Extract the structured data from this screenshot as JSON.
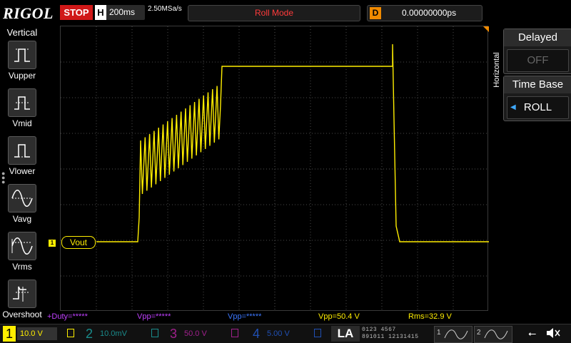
{
  "topbar": {
    "logo": "RIGOL",
    "run_state": "STOP",
    "timebase_tag": "H",
    "timebase": "200ms",
    "sample_rate": "2.50MSa/s",
    "mode": "Roll Mode",
    "delay_tag": "D",
    "delay": "0.00000000ps"
  },
  "left_menu": {
    "title": "Vertical",
    "items": [
      {
        "label": "Vupper",
        "icon": "vupper-icon"
      },
      {
        "label": "Vmid",
        "icon": "vmid-icon"
      },
      {
        "label": "Vlower",
        "icon": "vlower-icon"
      },
      {
        "label": "Vavg",
        "icon": "vavg-icon"
      },
      {
        "label": "Vrms",
        "icon": "vrms-icon"
      },
      {
        "label": "Overshoot",
        "icon": "overshoot-icon"
      }
    ]
  },
  "right_panel": {
    "section": "Horizontal",
    "delayed_title": "Delayed",
    "delayed_value": "OFF",
    "timebase_title": "Time Base",
    "timebase_value": "ROLL"
  },
  "trace": {
    "label_num": "1",
    "label": "Vout",
    "color": "#ffee00"
  },
  "measurements": [
    {
      "text": "+Duty=*****",
      "color": "#c040ff"
    },
    {
      "text": "Vpp=*****",
      "color": "#c040ff"
    },
    {
      "text": "Vpp=*****",
      "color": "#3c78ff"
    },
    {
      "text": "Vpp=50.4 V",
      "color": "#ffee00"
    },
    {
      "text": "Rms=32.9 V",
      "color": "#ffee00"
    }
  ],
  "channels": [
    {
      "num": "1",
      "value": "10.0 V",
      "color": "#ffee00",
      "active": true
    },
    {
      "num": "2",
      "value": "10.0mV",
      "color": "#1a8c8c",
      "active": false
    },
    {
      "num": "3",
      "value": "50.0 V",
      "color": "#a0208c",
      "active": false
    },
    {
      "num": "4",
      "value": "5.00 V",
      "color": "#2050b4",
      "active": false
    }
  ],
  "la": "LA",
  "digital_rows": [
    "0123 4567",
    "891011 12131415"
  ],
  "generators": [
    "1",
    "2"
  ],
  "status_icons": [
    "usb-icon",
    "speaker-muted-icon"
  ]
}
